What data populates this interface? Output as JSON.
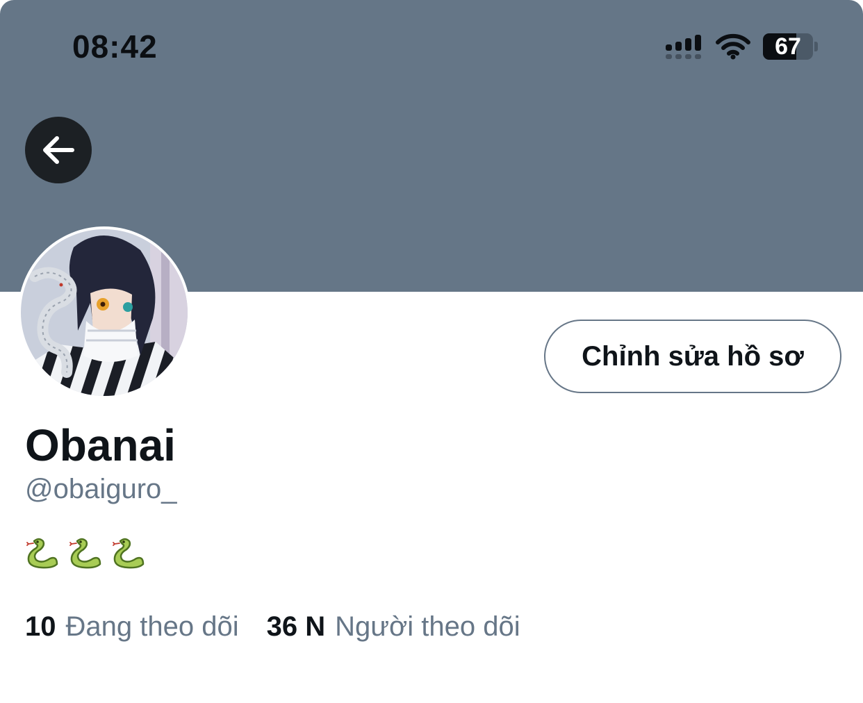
{
  "status_bar": {
    "time": "08:42",
    "battery_level": 67,
    "battery_label": "67",
    "icons": [
      "cellular-signal-icon",
      "wifi-icon",
      "battery-icon"
    ]
  },
  "header": {
    "back_icon": "arrow-left-icon",
    "banner_color": "#657687"
  },
  "profile": {
    "avatar_description": "profile-avatar",
    "edit_button_label": "Chỉnh sửa hồ sơ",
    "display_name": "Obanai",
    "handle": "@obaiguro_",
    "bio_emojis": [
      "snake-emoji",
      "snake-emoji",
      "snake-emoji"
    ],
    "following_count": "10",
    "following_label": "Đang theo dõi",
    "followers_count": "36 N",
    "followers_label": "Người theo dõi"
  },
  "colors": {
    "text_primary": "#0f1419",
    "text_secondary": "#667687",
    "back_button_bg": "#1c2024"
  }
}
